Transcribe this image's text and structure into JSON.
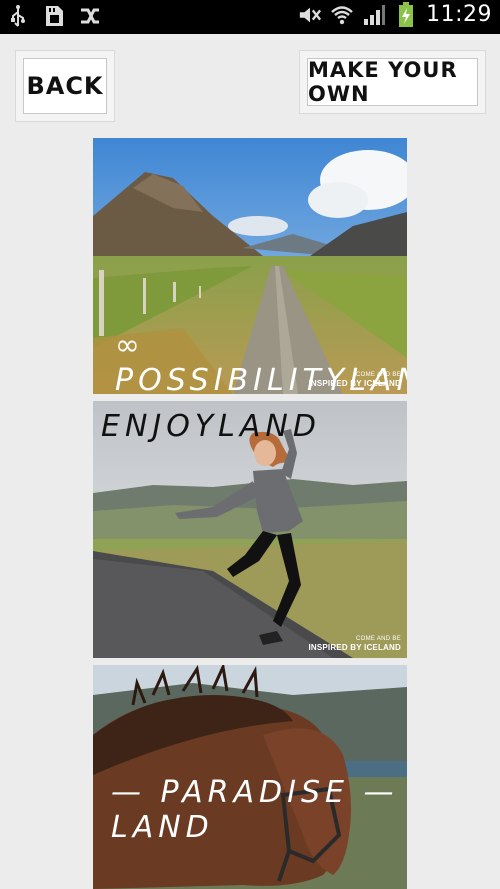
{
  "status_bar": {
    "time": "11:29",
    "icons": [
      "usb-icon",
      "sd-card-icon",
      "shuffle-icon",
      "mute-icon",
      "wifi-icon",
      "signal-icon",
      "battery-charging-icon"
    ]
  },
  "header": {
    "back_label": "BACK",
    "make_own_label": "MAKE YOUR OWN"
  },
  "cards": [
    {
      "title": "∞ POSSIBILITYLAND",
      "brand_small": "COME AND BE",
      "brand": "INSPIRED BY ICELAND"
    },
    {
      "title": "ENJOYLAND",
      "brand_small": "COME AND BE",
      "brand": "INSPIRED BY ICELAND"
    },
    {
      "title": "— PARADISE —LAND"
    }
  ]
}
